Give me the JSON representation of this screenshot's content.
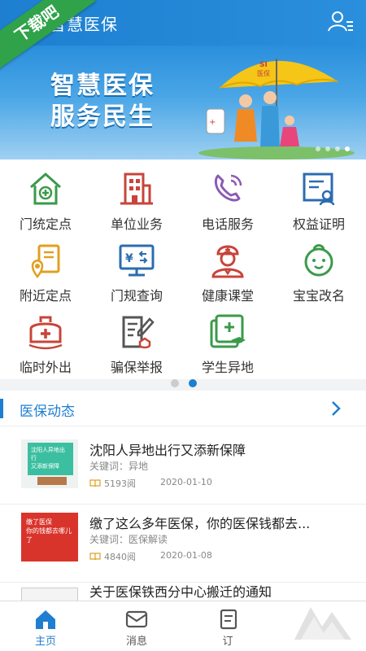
{
  "ribbon_text": "下载吧",
  "header": {
    "title": "阳智慧医保",
    "user_icon": "user-list-icon"
  },
  "banner": {
    "line1": "智慧医保",
    "line2": "服务民生",
    "umbrella_text": "SI\n医保",
    "slide_count": 4,
    "active_slide": 4
  },
  "services": [
    {
      "label": "门统定点",
      "icon": "house-plus-icon"
    },
    {
      "label": "单位业务",
      "icon": "building-icon"
    },
    {
      "label": "电话服务",
      "icon": "phone-icon"
    },
    {
      "label": "权益证明",
      "icon": "certificate-icon"
    },
    {
      "label": "附近定点",
      "icon": "location-doc-icon"
    },
    {
      "label": "门规查询",
      "icon": "monitor-yen-icon"
    },
    {
      "label": "健康课堂",
      "icon": "doctor-icon"
    },
    {
      "label": "宝宝改名",
      "icon": "baby-icon"
    },
    {
      "label": "临时外出",
      "icon": "medkit-icon"
    },
    {
      "label": "骗保举报",
      "icon": "report-pen-icon"
    },
    {
      "label": "学生异地",
      "icon": "student-card-icon"
    }
  ],
  "pager": {
    "count": 2,
    "active": 2
  },
  "news_section": {
    "title": "医保动态"
  },
  "news": [
    {
      "title": "沈阳人异地出行又添新保障",
      "keywords": "关键词：异地",
      "reads": "5193阅",
      "date": "2020-01-10",
      "thumb_text": "沈阳人异地出行\n又添新保障"
    },
    {
      "title": "缴了这么多年医保，你的医保钱都去...",
      "keywords": "关键词：医保解读",
      "reads": "4840阅",
      "date": "2020-01-08",
      "thumb_text": "缴了医保\n你的钱都去哪儿了"
    },
    {
      "title": "关于医保铁西分中心搬迁的通知",
      "keywords": "",
      "reads": "",
      "date": "",
      "thumb_text": ""
    }
  ],
  "tabs": [
    {
      "label": "主页",
      "icon": "home-icon",
      "active": true
    },
    {
      "label": "消息",
      "icon": "message-icon",
      "active": false
    },
    {
      "label": "订",
      "icon": "order-icon",
      "active": false
    }
  ],
  "colors": {
    "primary": "#1e7fd0",
    "icon_green": "#3a9a4a",
    "icon_red": "#c8443a",
    "icon_purple": "#8a5bb5",
    "icon_blue": "#2b6cb0"
  }
}
